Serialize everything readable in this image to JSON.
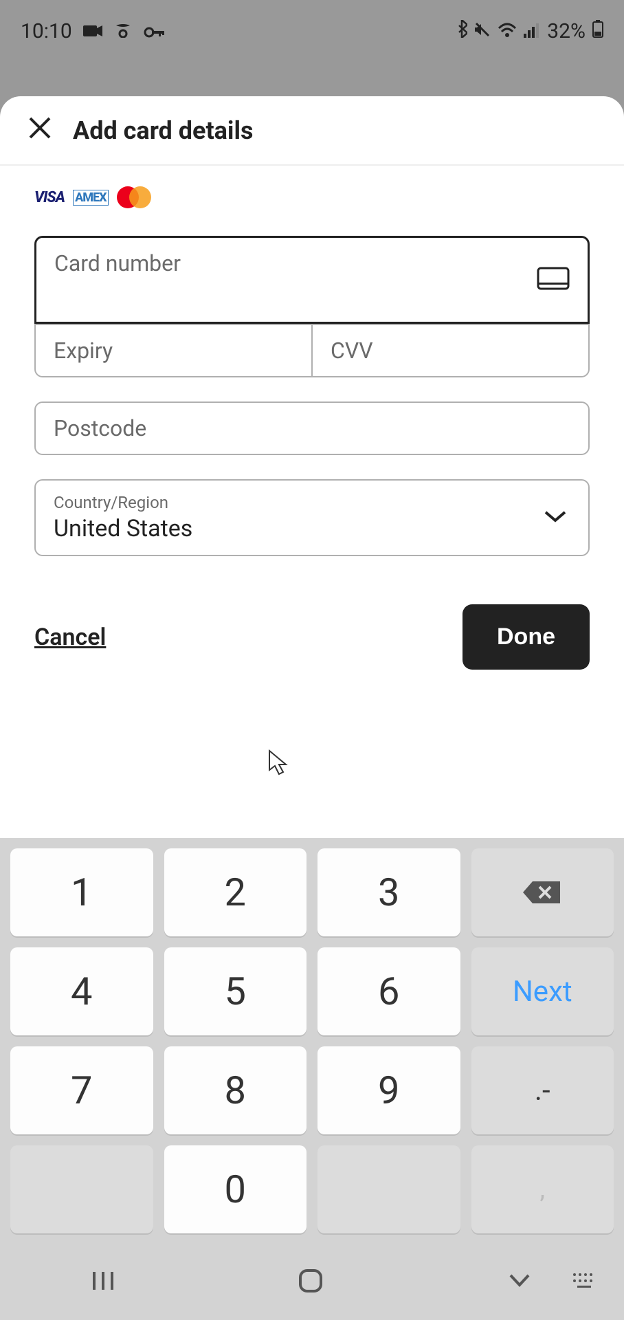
{
  "status": {
    "time": "10:10",
    "battery": "32%"
  },
  "modal": {
    "title": "Add card details"
  },
  "fields": {
    "card_number": {
      "label": "Card number",
      "value": ""
    },
    "expiry": {
      "label": "Expiry",
      "value": ""
    },
    "cvv": {
      "label": "CVV",
      "value": ""
    },
    "postcode": {
      "label": "Postcode",
      "value": ""
    },
    "country": {
      "label": "Country/Region",
      "value": "United States"
    }
  },
  "actions": {
    "cancel": "Cancel",
    "done": "Done"
  },
  "keyboard": {
    "keys": [
      [
        "1",
        "2",
        "3",
        "⌫"
      ],
      [
        "4",
        "5",
        "6",
        "Next"
      ],
      [
        "7",
        "8",
        "9",
        ".-"
      ],
      [
        "",
        "0",
        "",
        ","
      ]
    ]
  }
}
